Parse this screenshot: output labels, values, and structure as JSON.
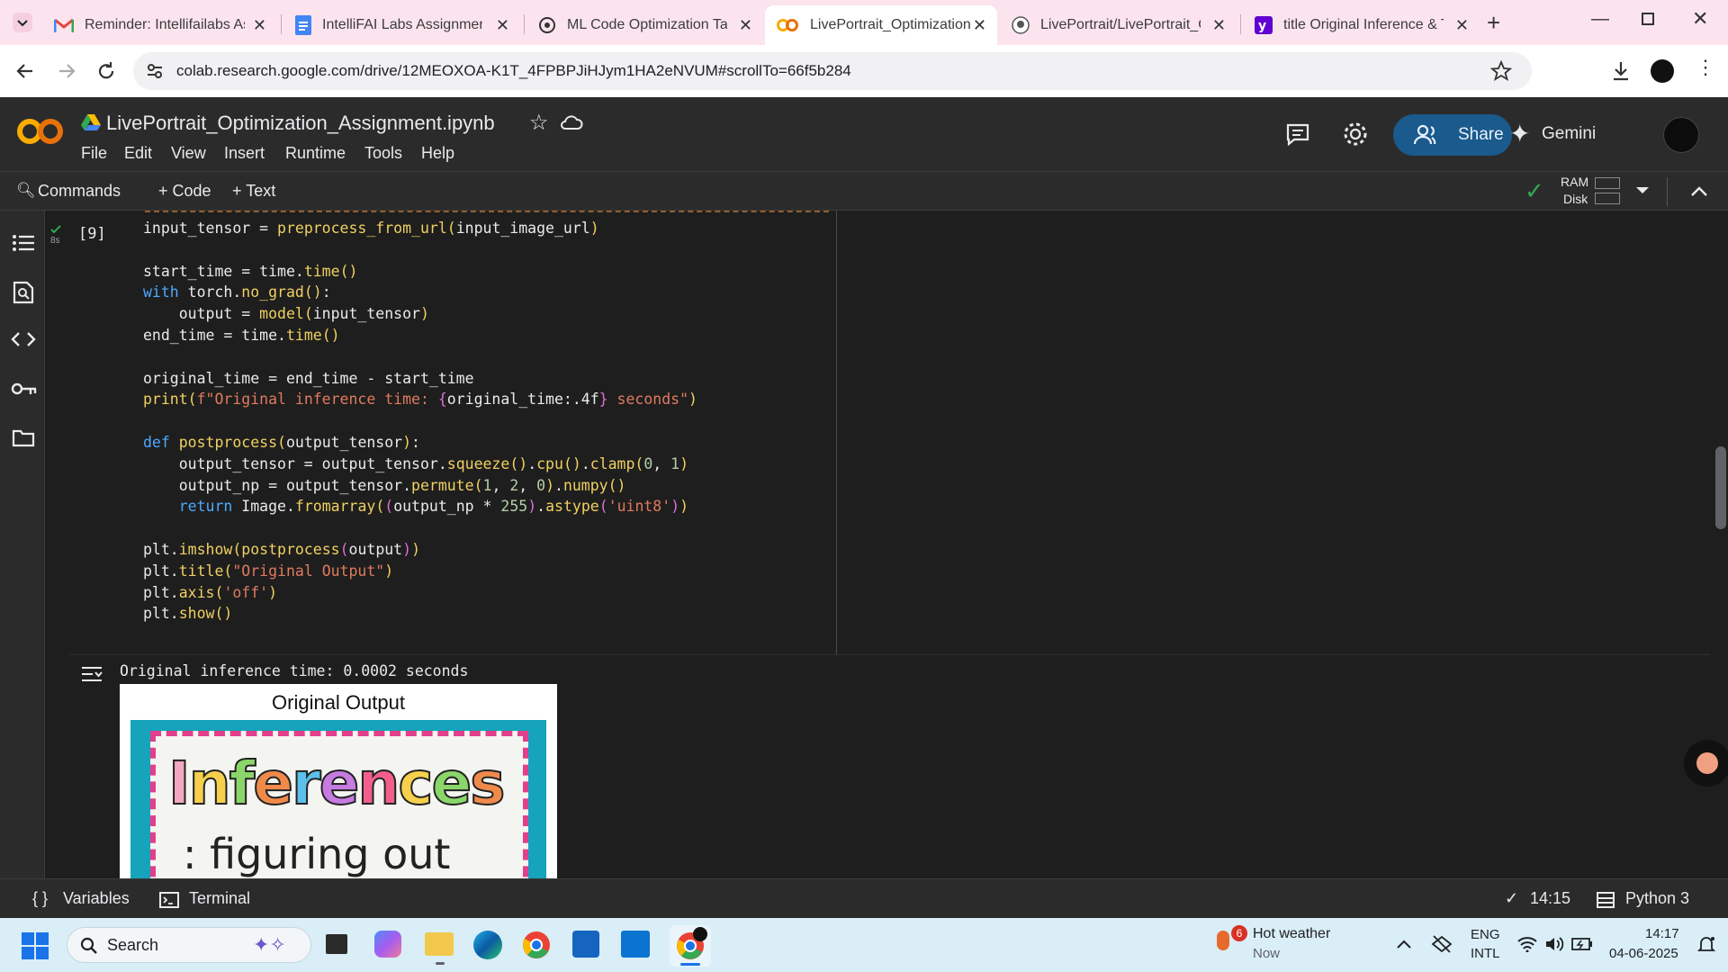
{
  "browser": {
    "tabs": [
      {
        "title": "Reminder: Intellifailabs Ass",
        "icon": "gmail-icon",
        "active": false
      },
      {
        "title": "IntelliFAI Labs Assignment",
        "icon": "docs-icon",
        "active": false
      },
      {
        "title": "ML Code Optimization Tasl",
        "icon": "openai-icon",
        "active": false
      },
      {
        "title": "LivePortrait_Optimization_",
        "icon": "colab-icon",
        "active": true
      },
      {
        "title": "LivePortrait/LivePortrait_O",
        "icon": "github-icon",
        "active": false
      },
      {
        "title": "title Original Inference & T",
        "icon": "yahoo-icon",
        "active": false
      }
    ],
    "url": "colab.research.google.com/drive/12MEOXOA-K1T_4FPBPJiHJym1HA2eNVUM#scrollTo=66f5b284"
  },
  "colab": {
    "notebook_title": "LivePortrait_Optimization_Assignment.ipynb",
    "menu": [
      "File",
      "Edit",
      "View",
      "Insert",
      "Runtime",
      "Tools",
      "Help"
    ],
    "share_label": "Share",
    "gemini_label": "Gemini",
    "commands_label": "Commands",
    "add_code_label": "+ Code",
    "add_text_label": "+ Text",
    "ram_label": "RAM",
    "disk_label": "Disk"
  },
  "cell": {
    "exec_count": "[9]",
    "run_time": "8s",
    "output_text": "Original inference time: 0.0002 seconds",
    "plot_title": "Original Output",
    "image_word": "Inferences",
    "image_subtext": ": figuring out"
  },
  "status": {
    "variables_label": "Variables",
    "terminal_label": "Terminal",
    "time": "14:15",
    "runtime": "Python 3"
  },
  "taskbar": {
    "search_label": "Search",
    "weather_title": "Hot weather",
    "weather_sub": "Now",
    "weather_badge": "6",
    "lang1": "ENG",
    "lang2": "INTL",
    "clock_time": "14:17",
    "clock_date": "04-06-2025"
  },
  "colors": {
    "accent_share": "#1a5a8c",
    "tab_strip": "#fce4ee",
    "editor_bg": "#1e1e1e"
  }
}
